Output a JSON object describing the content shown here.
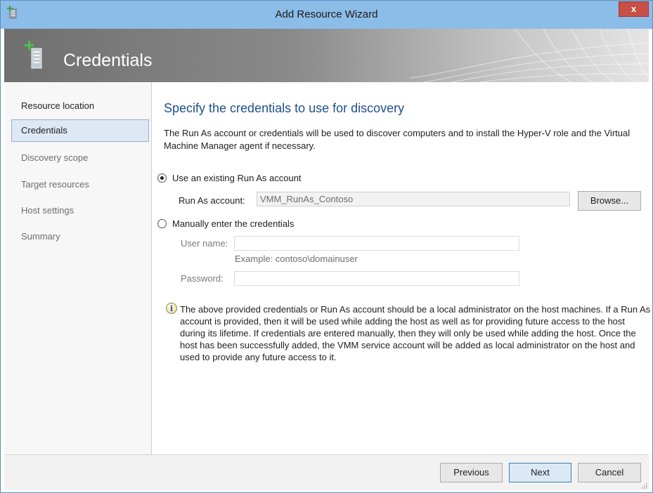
{
  "window": {
    "title": "Add Resource Wizard",
    "close_label": "x"
  },
  "banner": {
    "title": "Credentials"
  },
  "nav": {
    "items": [
      {
        "label": "Resource location",
        "state": "normal"
      },
      {
        "label": "Credentials",
        "state": "selected"
      },
      {
        "label": "Discovery scope",
        "state": "disabled"
      },
      {
        "label": "Target resources",
        "state": "disabled"
      },
      {
        "label": "Host settings",
        "state": "disabled"
      },
      {
        "label": "Summary",
        "state": "disabled"
      }
    ]
  },
  "main": {
    "heading": "Specify the credentials to use for discovery",
    "description": "The Run As account or credentials will be used to discover computers and to install the Hyper-V role and the Virtual Machine Manager agent if necessary.",
    "option_existing": {
      "label": "Use an existing Run As account",
      "checked": true,
      "runas_label": "Run As account:",
      "runas_value": "VMM_RunAs_Contoso",
      "browse_label": "Browse..."
    },
    "option_manual": {
      "label": "Manually enter the credentials",
      "checked": false,
      "username_label": "User name:",
      "username_value": "",
      "example": "Example: contoso\\domainuser",
      "password_label": "Password:",
      "password_value": ""
    },
    "info_text": "The above provided credentials or Run As account should be a local administrator on the host machines. If a Run As account is provided, then it will be used while adding the host as well as for providing future access to the host during its lifetime. If credentials are entered manually, then they will only be used while adding the host. Once the host has been successfully added, the VMM service account will be added as local administrator on the host and used to provide any future access to it."
  },
  "footer": {
    "previous_label": "Previous",
    "next_label": "Next",
    "cancel_label": "Cancel"
  },
  "colors": {
    "titlebar": "#8cbce8",
    "close_button": "#c74f45",
    "heading": "#1f4f8f",
    "nav_selected": "#dde8f4"
  },
  "icons": {
    "app": "add-resource-icon",
    "banner": "add-resource-icon",
    "info": "info-icon",
    "close": "close-icon"
  }
}
